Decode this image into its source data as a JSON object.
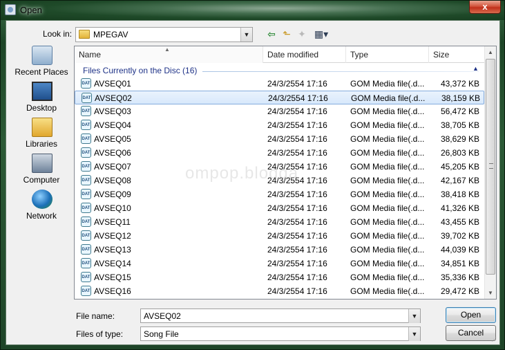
{
  "window": {
    "title": "Open",
    "close_glyph": "x"
  },
  "toolbar": {
    "lookin_label": "Look in:",
    "lookin_value": "MPEGAV",
    "icons": [
      "back-icon",
      "up-folder-icon",
      "new-folder-icon",
      "views-menu-icon"
    ]
  },
  "places": [
    {
      "label": "Recent Places",
      "icon": "recent-places-icon"
    },
    {
      "label": "Desktop",
      "icon": "desktop-icon"
    },
    {
      "label": "Libraries",
      "icon": "libraries-icon"
    },
    {
      "label": "Computer",
      "icon": "computer-icon"
    },
    {
      "label": "Network",
      "icon": "network-icon"
    }
  ],
  "columns": {
    "name": "Name",
    "date": "Date modified",
    "type": "Type",
    "size": "Size"
  },
  "group_header": "Files Currently on the Disc (16)",
  "files": [
    {
      "name": "AVSEQ01",
      "date": "24/3/2554 17:16",
      "type": "GOM Media file(.d...",
      "size": "43,372 KB"
    },
    {
      "name": "AVSEQ02",
      "date": "24/3/2554 17:16",
      "type": "GOM Media file(.d...",
      "size": "38,159 KB"
    },
    {
      "name": "AVSEQ03",
      "date": "24/3/2554 17:16",
      "type": "GOM Media file(.d...",
      "size": "56,472 KB"
    },
    {
      "name": "AVSEQ04",
      "date": "24/3/2554 17:16",
      "type": "GOM Media file(.d...",
      "size": "38,705 KB"
    },
    {
      "name": "AVSEQ05",
      "date": "24/3/2554 17:16",
      "type": "GOM Media file(.d...",
      "size": "38,629 KB"
    },
    {
      "name": "AVSEQ06",
      "date": "24/3/2554 17:16",
      "type": "GOM Media file(.d...",
      "size": "26,803 KB"
    },
    {
      "name": "AVSEQ07",
      "date": "24/3/2554 17:16",
      "type": "GOM Media file(.d...",
      "size": "45,205 KB"
    },
    {
      "name": "AVSEQ08",
      "date": "24/3/2554 17:16",
      "type": "GOM Media file(.d...",
      "size": "42,167 KB"
    },
    {
      "name": "AVSEQ09",
      "date": "24/3/2554 17:16",
      "type": "GOM Media file(.d...",
      "size": "38,418 KB"
    },
    {
      "name": "AVSEQ10",
      "date": "24/3/2554 17:16",
      "type": "GOM Media file(.d...",
      "size": "41,326 KB"
    },
    {
      "name": "AVSEQ11",
      "date": "24/3/2554 17:16",
      "type": "GOM Media file(.d...",
      "size": "43,455 KB"
    },
    {
      "name": "AVSEQ12",
      "date": "24/3/2554 17:16",
      "type": "GOM Media file(.d...",
      "size": "39,702 KB"
    },
    {
      "name": "AVSEQ13",
      "date": "24/3/2554 17:16",
      "type": "GOM Media file(.d...",
      "size": "44,039 KB"
    },
    {
      "name": "AVSEQ14",
      "date": "24/3/2554 17:16",
      "type": "GOM Media file(.d...",
      "size": "34,851 KB"
    },
    {
      "name": "AVSEQ15",
      "date": "24/3/2554 17:16",
      "type": "GOM Media file(.d...",
      "size": "35,336 KB"
    },
    {
      "name": "AVSEQ16",
      "date": "24/3/2554 17:16",
      "type": "GOM Media file(.d...",
      "size": "29,472 KB"
    }
  ],
  "selected_file": "AVSEQ02",
  "watermark": "ompop.blogga",
  "footer": {
    "filename_label": "File name:",
    "filename_value": "AVSEQ02",
    "filetype_label": "Files of type:",
    "filetype_value": "Song File",
    "open_label": "Open",
    "cancel_label": "Cancel"
  },
  "colors": {
    "group_header": "#1e3287",
    "selection": "#d7e8fb",
    "frame": "#1d4527"
  }
}
